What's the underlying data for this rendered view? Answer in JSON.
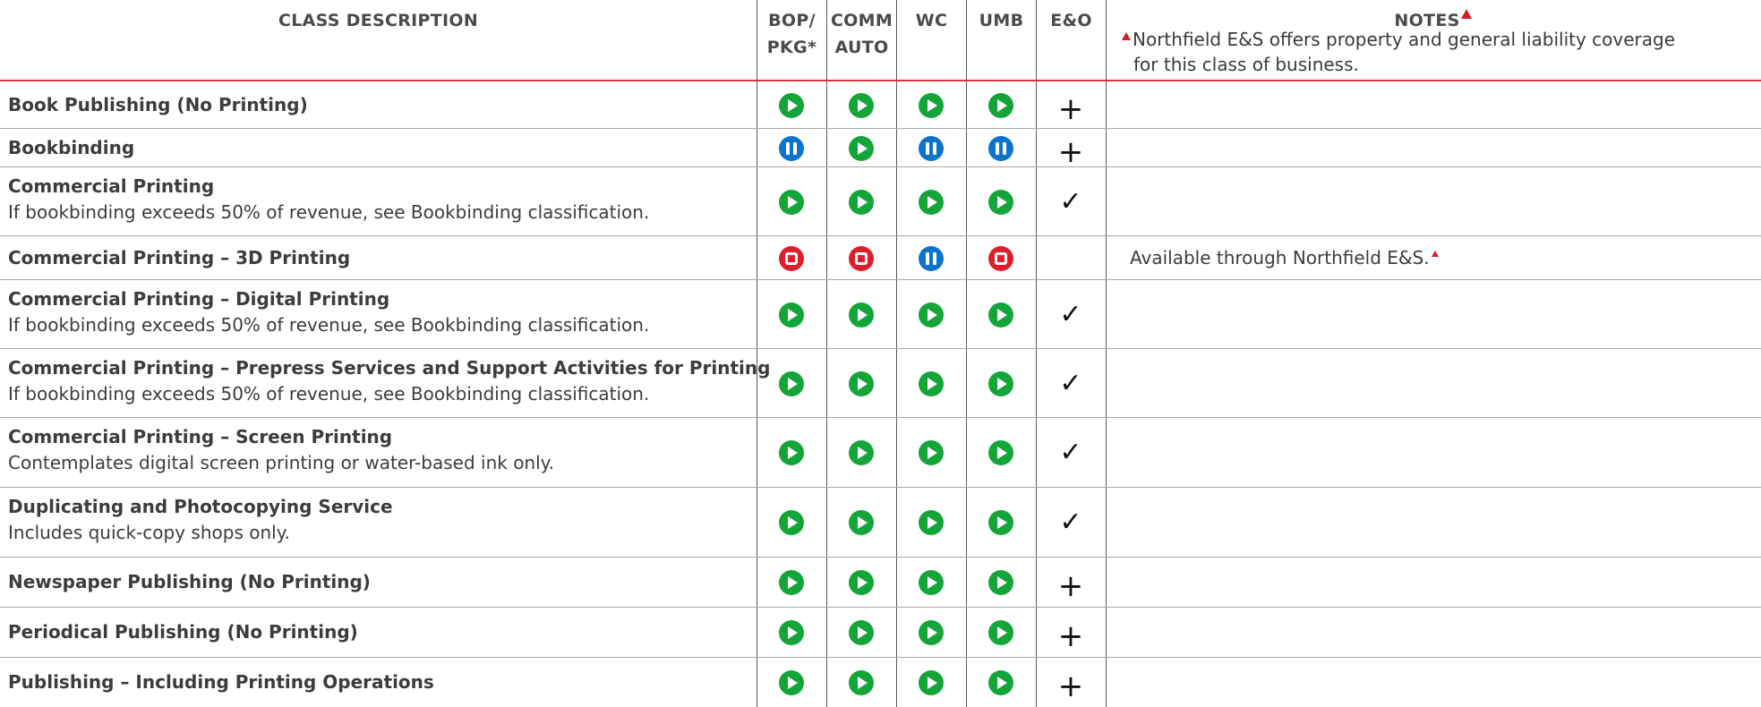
{
  "headers": {
    "class_description": "CLASS DESCRIPTION",
    "bop_line1": "BOP/",
    "bop_line2": "PKG*",
    "comm_line1": "COMM",
    "comm_line2": "AUTO",
    "wc": "WC",
    "umb": "UMB",
    "eo": "E&O",
    "notes": "NOTES"
  },
  "header_note": {
    "line1": "Northfield E&S offers property and general liability coverage",
    "line2": "for this class of business."
  },
  "colors": {
    "go": "#13a538",
    "pause": "#0b73c9",
    "stop": "#dc1f2c",
    "rule": "#e0313a"
  },
  "icon_legend": {
    "go": "green-play-icon",
    "pause": "blue-pause-icon",
    "stop": "red-stop-icon",
    "plus": "plus-mark",
    "check": "check-mark"
  },
  "rows": [
    {
      "title": "Book Publishing (No Printing)",
      "sub": "",
      "bop": "go",
      "comm": "go",
      "wc": "go",
      "umb": "go",
      "eo": "+",
      "note": ""
    },
    {
      "title": "Bookbinding",
      "sub": "",
      "bop": "pause",
      "comm": "go",
      "wc": "pause",
      "umb": "pause",
      "eo": "+",
      "note": ""
    },
    {
      "title": "Commercial Printing",
      "sub": "If bookbinding exceeds 50% of revenue, see Bookbinding classification.",
      "bop": "go",
      "comm": "go",
      "wc": "go",
      "umb": "go",
      "eo": "✓",
      "note": ""
    },
    {
      "title": "Commercial Printing – 3D Printing",
      "sub": "",
      "bop": "stop",
      "comm": "stop",
      "wc": "pause",
      "umb": "stop",
      "eo": "",
      "note": "Available through Northfield E&S."
    },
    {
      "title": "Commercial Printing – Digital Printing",
      "sub": "If bookbinding exceeds 50% of revenue, see Bookbinding classification.",
      "bop": "go",
      "comm": "go",
      "wc": "go",
      "umb": "go",
      "eo": "✓",
      "note": ""
    },
    {
      "title": "Commercial Printing – Prepress Services and Support Activities for Printing",
      "sub": "If bookbinding exceeds 50% of revenue, see Bookbinding classification.",
      "bop": "go",
      "comm": "go",
      "wc": "go",
      "umb": "go",
      "eo": "✓",
      "note": ""
    },
    {
      "title": "Commercial Printing – Screen Printing",
      "sub": "Contemplates digital screen printing or water-based ink only.",
      "bop": "go",
      "comm": "go",
      "wc": "go",
      "umb": "go",
      "eo": "✓",
      "note": ""
    },
    {
      "title": "Duplicating and Photocopying Service",
      "sub": "Includes quick-copy shops only.",
      "bop": "go",
      "comm": "go",
      "wc": "go",
      "umb": "go",
      "eo": "✓",
      "note": ""
    },
    {
      "title": "Newspaper Publishing (No Printing)",
      "sub": "",
      "bop": "go",
      "comm": "go",
      "wc": "go",
      "umb": "go",
      "eo": "+",
      "note": ""
    },
    {
      "title": "Periodical Publishing (No Printing)",
      "sub": "",
      "bop": "go",
      "comm": "go",
      "wc": "go",
      "umb": "go",
      "eo": "+",
      "note": ""
    },
    {
      "title": "Publishing – Including Printing Operations",
      "sub": "",
      "bop": "go",
      "comm": "go",
      "wc": "go",
      "umb": "go",
      "eo": "+",
      "note": ""
    }
  ]
}
